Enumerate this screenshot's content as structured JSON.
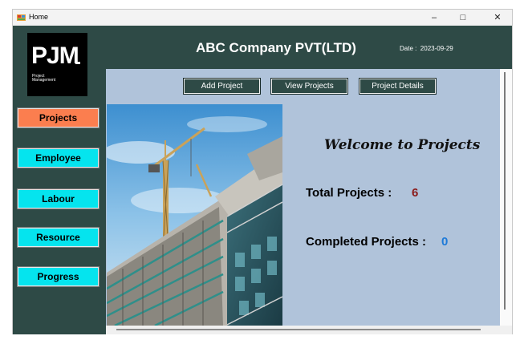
{
  "window": {
    "title": "Home",
    "controls": {
      "minimize": "–",
      "maximize": "□",
      "close": "✕"
    }
  },
  "logo": {
    "brand": "PJM",
    "line1": "Project",
    "line2": "Management"
  },
  "header": {
    "company": "ABC Company PVT(LTD)",
    "date_label": "Date :",
    "date_value": "2023-09-29"
  },
  "sidebar": {
    "items": [
      {
        "label": "Projects",
        "active": true
      },
      {
        "label": "Employee",
        "active": false
      },
      {
        "label": "Labour",
        "active": false
      },
      {
        "label": "Resource",
        "active": false
      },
      {
        "label": "Progress",
        "active": false
      }
    ]
  },
  "toolbar": {
    "add_project": "Add Project",
    "view_projects": "View Projects",
    "project_details": "Project Details"
  },
  "main": {
    "welcome": "Welcome to Projects",
    "total_label": "Total Projects :",
    "total_value": "6",
    "completed_label": "Completed Projects :",
    "completed_value": "0"
  },
  "colors": {
    "sidebar_bg": "#2e4a46",
    "panel_bg": "#b0c3da",
    "active_nav": "#fb7e4f",
    "nav_button": "#05e4ee",
    "total_value": "#8b1a1a",
    "completed_value": "#1e7ad8"
  }
}
